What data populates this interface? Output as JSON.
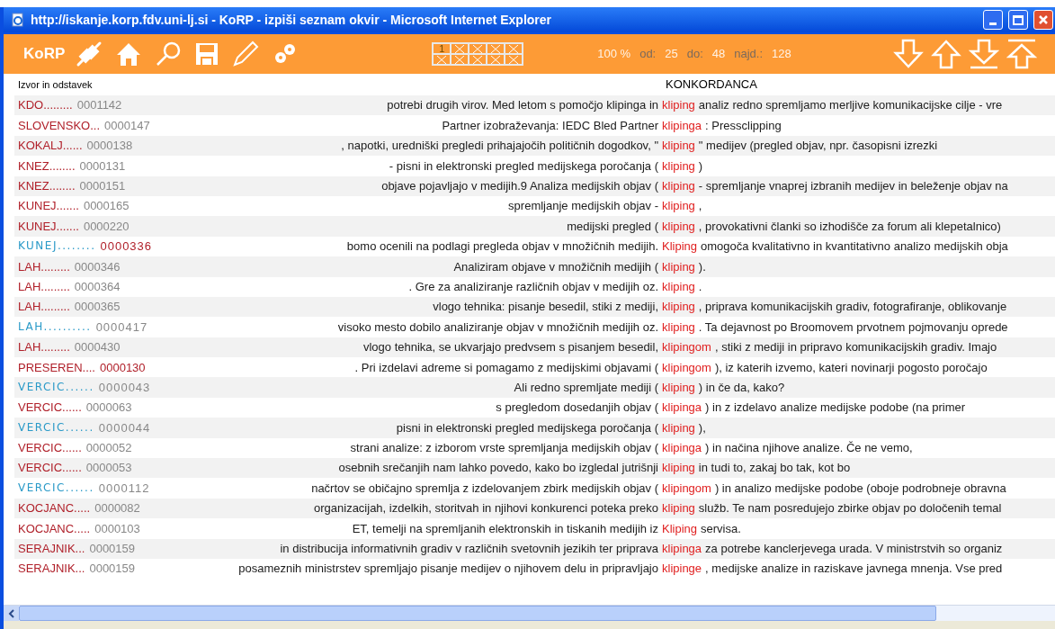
{
  "window": {
    "title": "http://iskanje.korp.fdv.uni-lj.si - KoRP - izpiši seznam okvir - Microsoft Internet Explorer"
  },
  "toolbar": {
    "logo": "KoRP",
    "page_grid": [
      {
        "kind": "number",
        "text": "1"
      },
      {
        "kind": "cross"
      },
      {
        "kind": "cross"
      },
      {
        "kind": "cross"
      },
      {
        "kind": "cross"
      },
      {
        "kind": "cross"
      },
      {
        "kind": "cross"
      },
      {
        "kind": "cross"
      },
      {
        "kind": "cross"
      },
      {
        "kind": "cross"
      }
    ],
    "stats": [
      {
        "text": "100 %",
        "kind": "value"
      },
      {
        "text": "od:",
        "kind": "label"
      },
      {
        "text": "25",
        "kind": "value"
      },
      {
        "text": "do:",
        "kind": "label"
      },
      {
        "text": "48",
        "kind": "value"
      },
      {
        "text": "najd.:",
        "kind": "label"
      },
      {
        "text": "128",
        "kind": "value"
      }
    ]
  },
  "table": {
    "columns": [
      "Izvor in odstavek",
      "KONKORDANCA"
    ],
    "rows": [
      {
        "source": "KDO.........",
        "number": "0001142",
        "kind": "standard",
        "number_marked": false,
        "left": "potrebi drugih virov. Med letom s pomočjo klipinga in",
        "keyword": "kliping",
        "right": "analiz redno spremljamo merljive komunikacijske cilje - vre"
      },
      {
        "source": "SLOVENSKO...",
        "number": "0000147",
        "kind": "standard",
        "number_marked": false,
        "left": "Partner izobraževanja: IEDC Bled Partner",
        "keyword": "klipinga",
        "right": ": Pressclipping"
      },
      {
        "source": "KOKALJ......",
        "number": "0000138",
        "kind": "standard",
        "number_marked": false,
        "left": ", napotki, uredniški pregledi prihajajočih političnih dogodkov, \"",
        "keyword": "kliping",
        "right": "\" medijev (pregled objav, npr. časopisni izrezki"
      },
      {
        "source": "KNEZ........",
        "number": "0000131",
        "kind": "standard",
        "number_marked": false,
        "left": "- pisni in elektronski pregled medijskega poročanja (",
        "keyword": "kliping",
        "right": ")"
      },
      {
        "source": "KNEZ........",
        "number": "0000151",
        "kind": "standard",
        "number_marked": false,
        "left": "objave pojavljajo v medijih.9 Analiza medijskih objav (",
        "keyword": "kliping",
        "right": "- spremljanje vnaprej izbranih medijev in beleženje objav na"
      },
      {
        "source": "KUNEJ.......",
        "number": "0000165",
        "kind": "standard",
        "number_marked": false,
        "left": "spremljanje medijskih objav -",
        "keyword": "kliping",
        "right": ","
      },
      {
        "source": "KUNEJ.......",
        "number": "0000220",
        "kind": "standard",
        "number_marked": false,
        "left": "medijski pregled (",
        "keyword": "kliping",
        "right": ", provokativni članki so izhodišče za forum ali klepetalnico)"
      },
      {
        "source": "KUNEJ........",
        "number": "0000336",
        "kind": "alternate",
        "number_marked": true,
        "left": "bomo ocenili na podlagi pregleda objav v množičnih medijih.",
        "keyword": "Kliping",
        "right": "omogoča kvalitativno in kvantitativno analizo medijskih obja"
      },
      {
        "source": "LAH.........",
        "number": "0000346",
        "kind": "standard",
        "number_marked": false,
        "left": "Analiziram objave v množičnih medijih (",
        "keyword": "kliping",
        "right": ")."
      },
      {
        "source": "LAH.........",
        "number": "0000364",
        "kind": "standard",
        "number_marked": false,
        "left": ". Gre za analiziranje različnih objav v medijih oz.",
        "keyword": "kliping",
        "right": "."
      },
      {
        "source": "LAH.........",
        "number": "0000365",
        "kind": "standard",
        "number_marked": false,
        "left": "vlogo tehnika: pisanje besedil, stiki z mediji,",
        "keyword": "kliping",
        "right": ", priprava komunikacijskih gradiv, fotografiranje, oblikovanje"
      },
      {
        "source": "LAH..........",
        "number": "0000417",
        "kind": "alternate",
        "number_marked": false,
        "left": "visoko mesto dobilo analiziranje objav v množičnih medijih oz.",
        "keyword": "kliping",
        "right": ". Ta dejavnost po Broomovem prvotnem pojmovanju oprede"
      },
      {
        "source": "LAH.........",
        "number": "0000430",
        "kind": "standard",
        "number_marked": false,
        "left": "vlogo tehnika, se ukvarjajo predvsem s pisanjem besedil,",
        "keyword": "klipingom",
        "right": ", stiki z mediji in pripravo komunikacijskih gradiv. Imajo"
      },
      {
        "source": "PRESEREN....",
        "number": "0000130",
        "kind": "standard",
        "number_marked": true,
        "left": ". Pri izdelavi adreme si pomagamo z medijskimi objavami (",
        "keyword": "klipingom",
        "right": "), iz katerih izvemo, kateri novinarji pogosto poročajo"
      },
      {
        "source": "VERCIC......",
        "number": "0000043",
        "kind": "alternate",
        "number_marked": false,
        "left": "Ali redno spremljate mediji (",
        "keyword": "kliping",
        "right": ") in če da, kako?"
      },
      {
        "source": "VERCIC......",
        "number": "0000063",
        "kind": "standard",
        "number_marked": false,
        "left": "s pregledom dosedanjih objav (",
        "keyword": "klipinga",
        "right": ") in z izdelavo analize medijske podobe (na primer"
      },
      {
        "source": "VERCIC......",
        "number": "0000044",
        "kind": "alternate",
        "number_marked": false,
        "left": "pisni in elektronski pregled medijskega poročanja (",
        "keyword": "kliping",
        "right": "),"
      },
      {
        "source": "VERCIC......",
        "number": "0000052",
        "kind": "standard",
        "number_marked": false,
        "left": "strani analize: z izborom vrste spremljanja medijskih objav (",
        "keyword": "klipinga",
        "right": ") in načina njihove analize. Če ne vemo,"
      },
      {
        "source": "VERCIC......",
        "number": "0000053",
        "kind": "standard",
        "number_marked": false,
        "left": "osebnih srečanjih nam lahko povedo, kako bo izgledal jutrišnji",
        "keyword": "kliping",
        "right": "in tudi to, zakaj bo tak, kot bo"
      },
      {
        "source": "VERCIC......",
        "number": "0000112",
        "kind": "alternate",
        "number_marked": false,
        "left": "načrtov se običajno spremlja z izdelovanjem zbirk medijskih objav (",
        "keyword": "klipingom",
        "right": ") in analizo medijske podobe (oboje podrobneje obravna"
      },
      {
        "source": "KOCJANC.....",
        "number": "0000082",
        "kind": "standard",
        "number_marked": false,
        "left": "organizacijah, izdelkih, storitvah in njihovi konkurenci poteka preko",
        "keyword": "kliping",
        "right": "služb. Te nam posredujejo zbirke objav po določenih temal"
      },
      {
        "source": "KOCJANC.....",
        "number": "0000103",
        "kind": "standard",
        "number_marked": false,
        "left": "ET, temelji na spremljanih elektronskih in tiskanih medijih iz",
        "keyword": "Kliping",
        "right": "servisa."
      },
      {
        "source": "SERAJNIK...",
        "number": "0000159",
        "kind": "standard",
        "number_marked": false,
        "left": "in distribucija informativnih gradiv v različnih svetovnih jezikih ter priprava",
        "keyword": "klipinga",
        "right": "za potrebe kanclerjevega urada. V ministrstvih so organiz"
      },
      {
        "source": "SERAJNIK...",
        "number": "0000159",
        "kind": "standard",
        "number_marked": false,
        "left": "posameznih ministrstev spremljajo pisanje medijev o njihovem delu in pripravljajo",
        "keyword": "klipinge",
        "right": ", medijske analize in raziskave javnega mnenja. Vse pred"
      }
    ]
  }
}
